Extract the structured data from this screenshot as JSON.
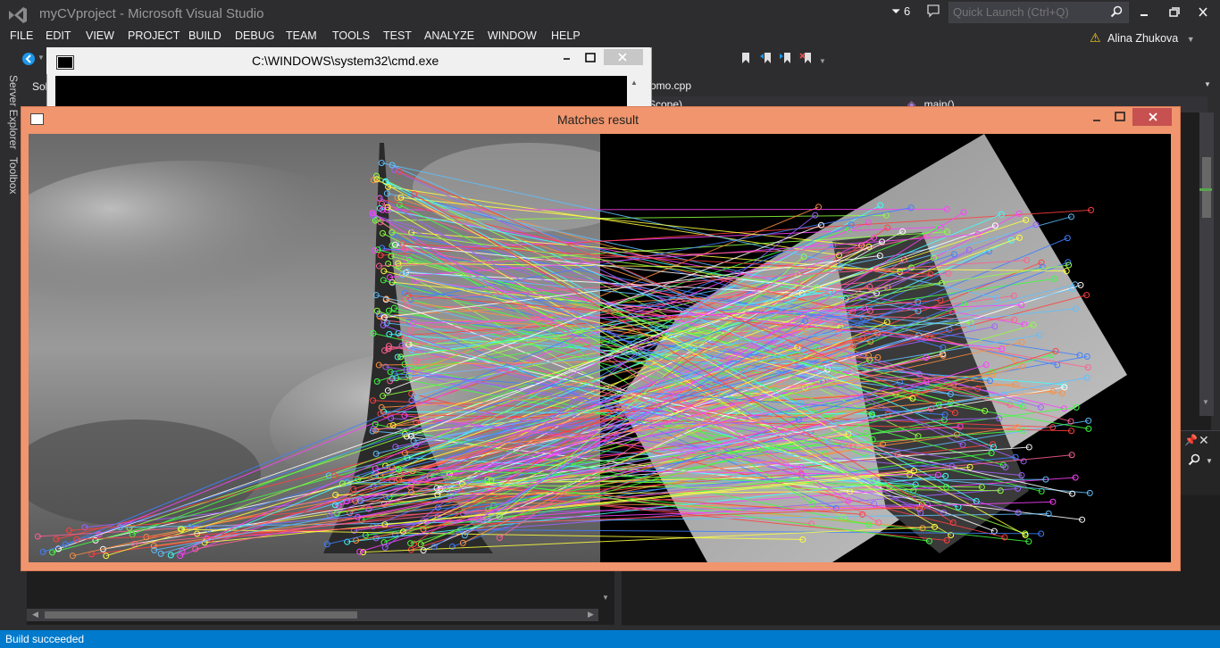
{
  "window": {
    "title": "myCVproject - Microsoft Visual Studio",
    "notification_count": "6",
    "quick_launch_placeholder": "Quick Launch (Ctrl+Q)"
  },
  "menu": [
    "FILE",
    "EDIT",
    "VIEW",
    "PROJECT",
    "BUILD",
    "DEBUG",
    "TEAM",
    "TOOLS",
    "TEST",
    "ANALYZE",
    "WINDOW",
    "HELP"
  ],
  "user": {
    "name": "Alina Zhukova"
  },
  "left_rail": {
    "server_explorer": "Server Explorer",
    "toolbox": "Toolbox"
  },
  "solution_explorer_fragment": "Sol",
  "editor": {
    "tab_label": "omo.cpp",
    "scope_label": "Scope)",
    "function_label": "main()"
  },
  "cmd_window": {
    "title": "C:\\WINDOWS\\system32\\cmd.exe"
  },
  "matches_window": {
    "title": "Matches result"
  },
  "status": {
    "text": "Build succeeded"
  },
  "colors": {
    "vs_background": "#2d2d30",
    "status_bar": "#007acc",
    "matches_frame": "#f0956d",
    "close_button": "#c75050",
    "warning": "#f2c811"
  },
  "icons": {
    "vs_logo": "visual-studio-logo",
    "notification": "flag-icon",
    "feedback": "speech-bubble-icon",
    "search": "search-icon",
    "warning": "warning-icon"
  }
}
